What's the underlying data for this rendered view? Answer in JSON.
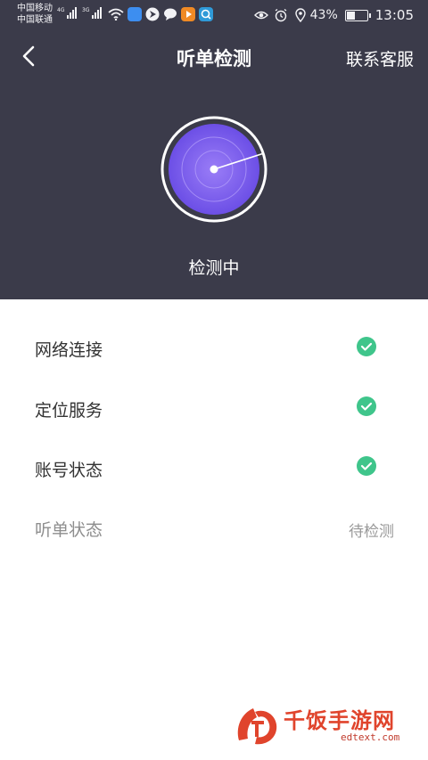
{
  "statusbar": {
    "carrier_1": "中国移动",
    "carrier_2": "中国联通",
    "sim1_network": "4G",
    "sim2_network": "3G",
    "battery_percent": "43%",
    "battery_level": 0.43,
    "time": "13:05",
    "icons": [
      "wifi-icon",
      "app-notification-icon",
      "location-arrow-icon",
      "message-bubble-icon",
      "video-app-icon",
      "search-app-icon",
      "eye-comfort-icon",
      "alarm-icon",
      "location-icon",
      "battery-icon"
    ]
  },
  "header": {
    "back_icon": "chevron-left-icon",
    "title": "听单检测",
    "contact_label": "联系客服"
  },
  "radar": {
    "icon": "radar-scan-icon",
    "status_text": "检测中"
  },
  "checks": [
    {
      "label": "网络连接",
      "state": "ok",
      "icon": "check-circle-icon"
    },
    {
      "label": "定位服务",
      "state": "ok",
      "icon": "check-circle-icon"
    },
    {
      "label": "账号状态",
      "state": "ok",
      "icon": "check-circle-icon"
    },
    {
      "label": "听单状态",
      "state": "pending",
      "status_text": "待检测"
    }
  ],
  "colors": {
    "header_bg": "#3b3b4a",
    "radar_purple": "#7a5cf0",
    "check_green": "#3fc58b",
    "watermark_red": "#e0442c"
  },
  "watermark": {
    "text": "千饭手游网",
    "sub": "edtext.com"
  }
}
